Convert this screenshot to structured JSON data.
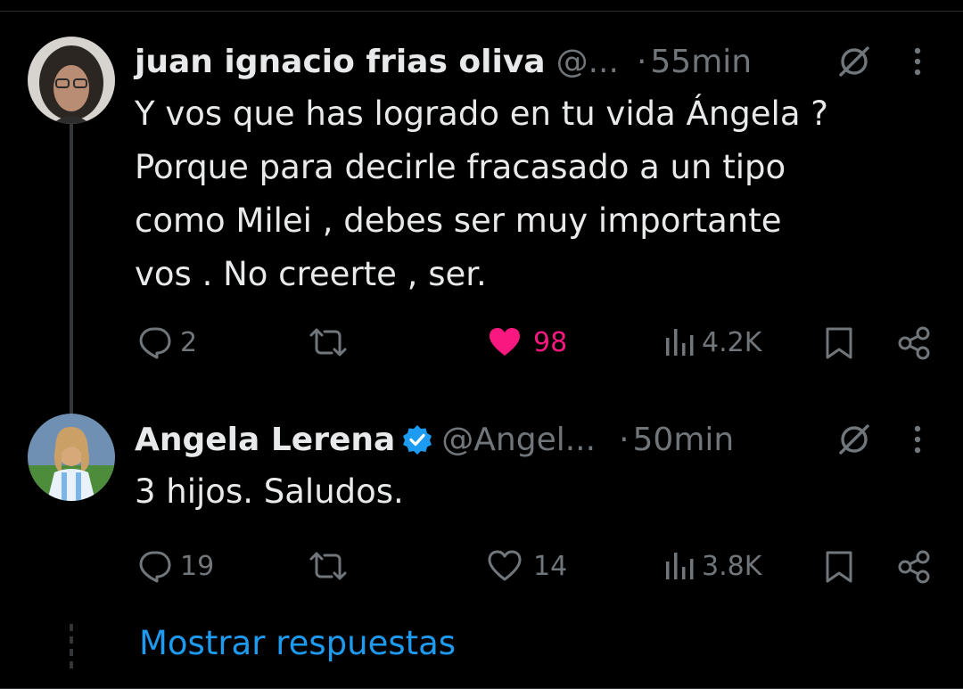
{
  "thread": {
    "show_replies_label": "Mostrar respuestas",
    "tweets": [
      {
        "author_name": "juan ignacio frias oliva",
        "handle": "@...",
        "separator": "·",
        "time": "55min",
        "verified": false,
        "text_lines": [
          "Y vos que has logrado en tu vida Ángela ?",
          "Porque para decirle fracasado a un tipo",
          "como Milei , debes ser muy importante",
          "vos . No creerte , ser."
        ],
        "replies": "2",
        "reposts": "",
        "likes": "98",
        "liked": true,
        "views": "4.2K"
      },
      {
        "author_name": "Angela Lerena",
        "handle": "@Angel...",
        "separator": "·",
        "time": "50min",
        "verified": true,
        "text_lines": [
          "3 hijos. Saludos."
        ],
        "replies": "19",
        "reposts": "",
        "likes": "14",
        "liked": false,
        "views": "3.8K"
      }
    ]
  },
  "colors": {
    "background": "#000000",
    "text": "#e7e9ea",
    "muted": "#71767b",
    "like_active": "#f91880",
    "link_blue": "#1d9bf0",
    "verified_blue": "#1d9bf0"
  },
  "icons": [
    "avatar",
    "grok-icon",
    "more-icon",
    "reply-icon",
    "repost-icon",
    "like-icon",
    "views-icon",
    "bookmark-icon",
    "share-icon",
    "verified-badge-icon"
  ]
}
